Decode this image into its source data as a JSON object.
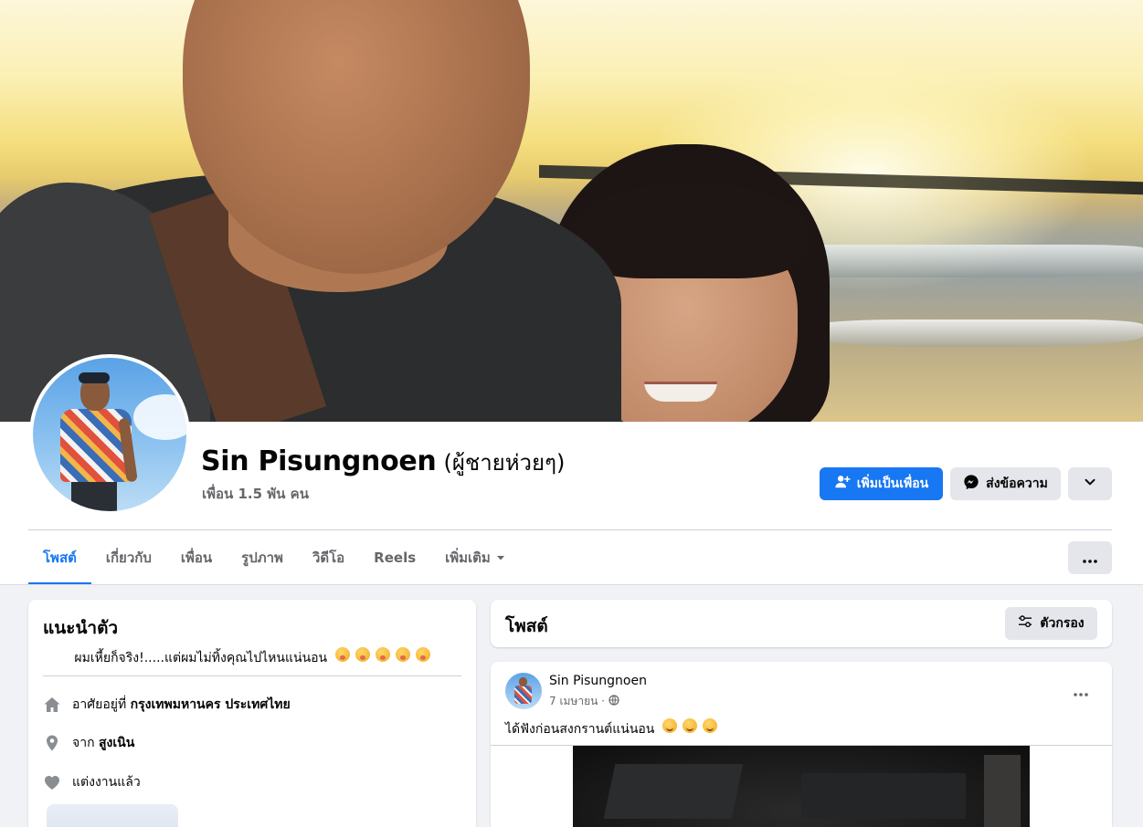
{
  "profile": {
    "name": "Sin Pisungnoen",
    "alt_name": "(ผู้ชายห่วยๆ)",
    "friends_count": "เพื่อน 1.5 พัน คน"
  },
  "actions": {
    "add_friend": "เพิ่มเป็นเพื่อน",
    "message": "ส่งข้อความ"
  },
  "tabs": [
    {
      "label": "โพสต์",
      "active": true
    },
    {
      "label": "เกี่ยวกับ"
    },
    {
      "label": "เพื่อน"
    },
    {
      "label": "รูปภาพ"
    },
    {
      "label": "วิดีโอ"
    },
    {
      "label": "Reels"
    },
    {
      "label": "เพิ่มเติม"
    }
  ],
  "intro": {
    "title": "แนะนำตัว",
    "bio": "ผมเหี้ยก็จริง!.....แต่ผมไม่ทิ้งคุณไปไหนแน่นอน",
    "lives_label": "อาศัยอยู่ที่",
    "lives_value": "กรุงเทพมหานคร ประเทศไทย",
    "from_label": "จาก",
    "from_value": "สูงเนิน",
    "relationship": "แต่งงานแล้ว"
  },
  "posts_section": {
    "title": "โพสต์",
    "filter_label": "ตัวกรอง"
  },
  "post": {
    "author": "Sin Pisungnoen",
    "date": "7 เมษายน ·",
    "text": "ได้ฟังก่อนสงกรานต์แน่นอน"
  },
  "colors": {
    "primary": "#1877f2",
    "secondary_button": "#e4e6eb",
    "page_bg": "#f0f2f5",
    "muted_text": "#65676b"
  },
  "icons": {
    "add_friend": "person-plus-icon",
    "message": "messenger-icon",
    "more": "chevron-down-icon",
    "tab_more": "caret-down-icon",
    "overflow": "ellipsis-icon",
    "home": "home-icon",
    "location": "location-pin-icon",
    "relationship": "heart-icon",
    "filter": "sliders-icon",
    "privacy": "globe-icon",
    "bio_emoji": "shushing-face-icon",
    "post_emoji": "smiling-face-icon"
  }
}
